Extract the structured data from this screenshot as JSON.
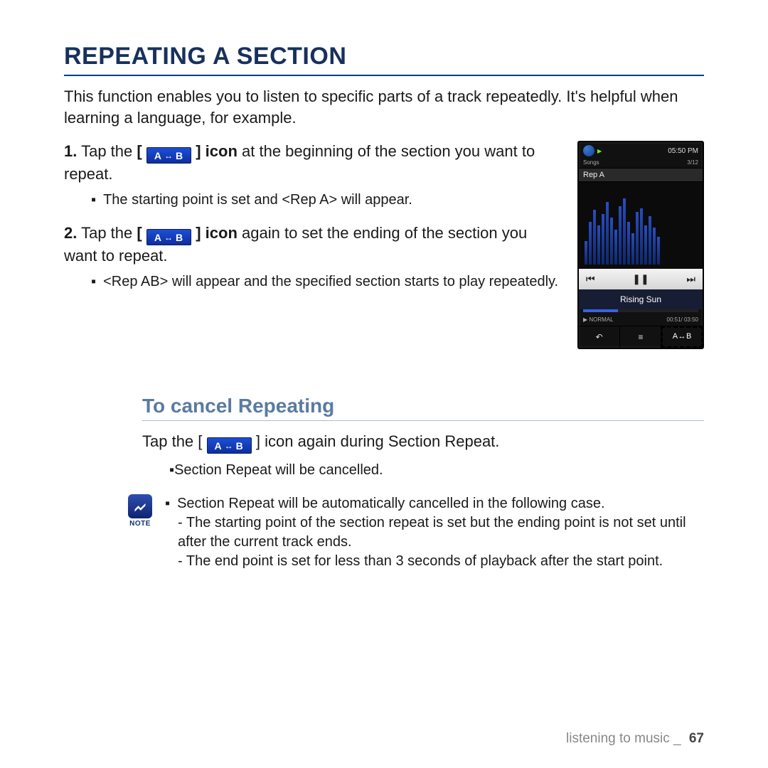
{
  "title": "REPEATING A SECTION",
  "intro": "This function enables you to listen to specific parts of a track repeatedly. It's helpful when learning a language, for example.",
  "icon": {
    "a": "A",
    "b": "B"
  },
  "steps": [
    {
      "num": "1.",
      "pre": "Tap the",
      "bold": "icon",
      "post": "at the beginning of the section you want to repeat.",
      "sub": "The starting point is set and <Rep A> will appear."
    },
    {
      "num": "2.",
      "pre": "Tap the",
      "bold": "icon",
      "post": "again to set the ending of the section you want to repeat.",
      "sub": "<Rep AB> will appear and the specified section starts to play repeatedly."
    }
  ],
  "device": {
    "time": "05:50 PM",
    "menu": "Songs",
    "index": "3/12",
    "rep": "Rep A",
    "eq_heights": [
      30,
      55,
      70,
      50,
      65,
      80,
      60,
      45,
      75,
      85,
      55,
      40,
      68,
      72,
      50,
      62,
      48,
      36
    ],
    "song": "Rising Sun",
    "mode": "NORMAL",
    "elapsed": "00:51/ 03:50",
    "toolbar": {
      "back": "↶",
      "list": "≡",
      "ab": "A↔B"
    }
  },
  "sub2": {
    "title": "To cancel Repeating",
    "step_pre": "Tap the",
    "step_bold": "icon",
    "step_post": "again during Section Repeat.",
    "sub": "Section Repeat will be cancelled."
  },
  "note": {
    "label": "NOTE",
    "line1": "Section Repeat will be automatically cancelled in the following case.",
    "dash1": "- The starting point of the section repeat is set but the ending point is not set until after the current track ends.",
    "dash2": "- The end point is set for less than 3 seconds of playback after the start point."
  },
  "footer": {
    "section": "listening to music _",
    "page": "67"
  }
}
